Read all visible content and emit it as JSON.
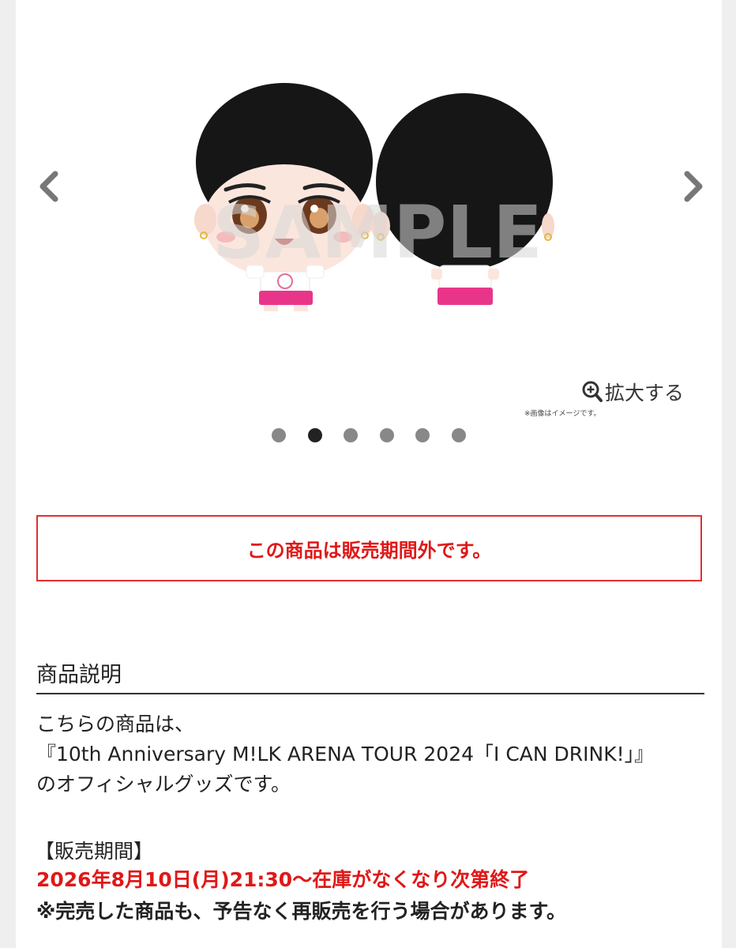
{
  "carousel": {
    "prev_icon": "chevron-left-icon",
    "next_icon": "chevron-right-icon",
    "watermark": "SAMPLE",
    "zoom_icon": "zoom-in-icon",
    "zoom_label": "拡大する",
    "image_note": "※画像はイメージです。",
    "dot_count": 6,
    "active_dot_index": 1
  },
  "notice": {
    "text": "この商品は販売期間外です。",
    "color": "#e01818"
  },
  "description": {
    "title": "商品説明",
    "lines": [
      "こちらの商品は、",
      "『10th Anniversary M!LK ARENA TOUR 2024「I CAN DRINK!」』",
      "のオフィシャルグッズです。"
    ],
    "sale_heading": "【販売期間】",
    "sale_period": "2026年8月10日(月)21:30〜在庫がなくなり次第終了",
    "sale_note": "※完売した商品も、予告なく再販売を行う場合があります。"
  }
}
